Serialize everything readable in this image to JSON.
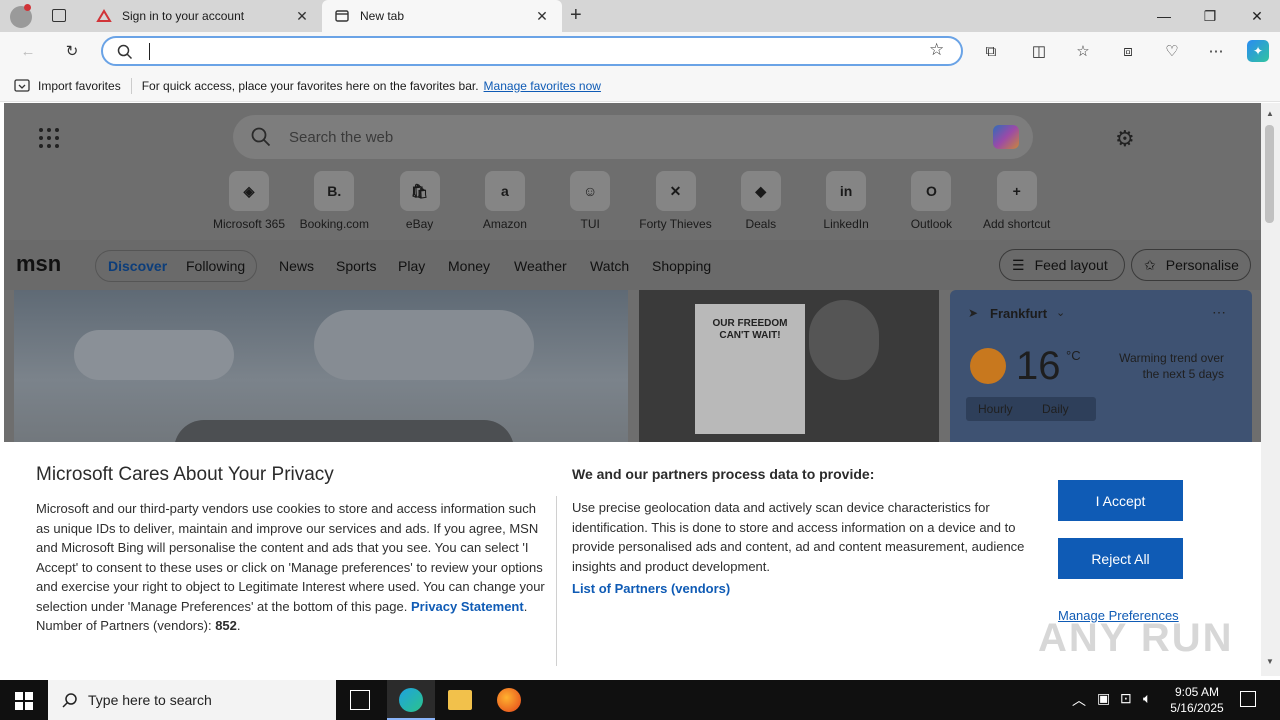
{
  "browser": {
    "tabs": [
      {
        "title": "Sign in to your account"
      },
      {
        "title": "New tab"
      }
    ],
    "address_value": "",
    "favorites_bar": {
      "import_label": "Import favorites",
      "hint": "For quick access, place your favorites here on the favorites bar.",
      "manage_link": "Manage favorites now"
    }
  },
  "newtab": {
    "search_placeholder": "Search the web",
    "shortcuts": [
      {
        "label": "Microsoft 365",
        "glyph": "◈"
      },
      {
        "label": "Booking.com",
        "glyph": "B."
      },
      {
        "label": "eBay",
        "glyph": "🛍"
      },
      {
        "label": "Amazon",
        "glyph": "a"
      },
      {
        "label": "TUI",
        "glyph": "☺"
      },
      {
        "label": "Forty Thieves",
        "glyph": "✕"
      },
      {
        "label": "Deals",
        "glyph": "◆"
      },
      {
        "label": "LinkedIn",
        "glyph": "in"
      },
      {
        "label": "Outlook",
        "glyph": "O"
      },
      {
        "label": "Add shortcut",
        "glyph": "+"
      }
    ]
  },
  "msn": {
    "logo": "msn",
    "tabs": [
      "Discover",
      "Following"
    ],
    "nav": [
      "News",
      "Sports",
      "Play",
      "Money",
      "Weather",
      "Watch",
      "Shopping"
    ],
    "feed_layout": "Feed layout",
    "personalise": "Personalise",
    "card2_headline": "OUR FREEDOM CAN'T WAIT!"
  },
  "weather": {
    "city": "Frankfurt",
    "temp": "16",
    "unit": "°C",
    "trend": "Warming trend over the next 5 days",
    "toggle": [
      "Hourly",
      "Daily"
    ]
  },
  "privacy": {
    "title": "Microsoft Cares About Your Privacy",
    "body": "Microsoft and our third-party vendors use cookies to store and access information such as unique IDs to deliver, maintain and improve our services and ads. If you agree, MSN and Microsoft Bing will personalise the content and ads that you see. You can select 'I Accept' to consent to these uses or click on 'Manage preferences' to review your options and exercise your right to object to Legitimate Interest where used.  You can change your selection under 'Manage Preferences' at the bottom of this page.",
    "privacy_link": "Privacy Statement",
    "partners_count_label": "Number of Partners (vendors):",
    "partners_count": "852",
    "heading2": "We and our partners process data to provide:",
    "body2": "Use precise geolocation data and actively scan device characteristics for identification. This is done to store and access information on a device and to provide personalised ads and content, ad and content measurement, audience insights and product development.",
    "partners_link": "List of Partners (vendors)",
    "accept": "I Accept",
    "reject": "Reject All",
    "manage": "Manage Preferences"
  },
  "watermark": "ANY RUN",
  "taskbar": {
    "search_placeholder": "Type here to search",
    "time": "9:05 AM",
    "date": "5/16/2025"
  }
}
